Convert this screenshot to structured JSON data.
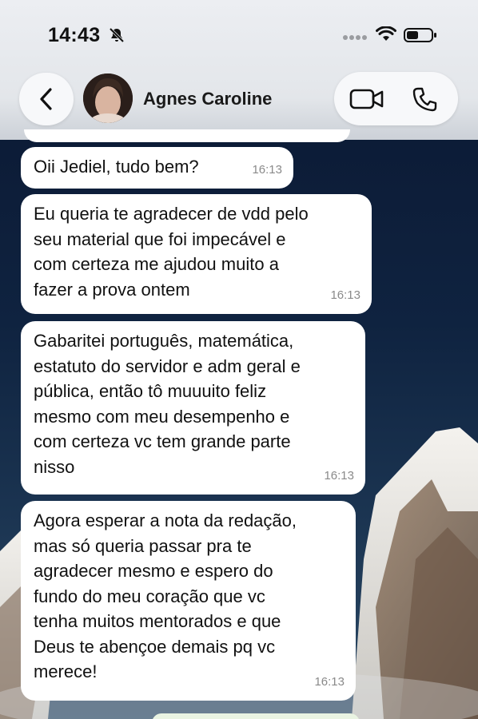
{
  "status_bar": {
    "time": "14:43",
    "icons": [
      "bell-off-icon",
      "signal-icon",
      "wifi-icon",
      "battery-icon"
    ]
  },
  "header": {
    "contact_name": "Agnes Caroline",
    "icons": [
      "chevron-left-icon",
      "video-camera-icon",
      "phone-icon"
    ]
  },
  "messages": [
    {
      "text": "Oii Jediel, tudo bem?",
      "time": "16:13"
    },
    {
      "text": "Eu queria te agradecer de vdd pelo\nseu material que foi impecável e\ncom certeza me ajudou muito a\nfazer a prova ontem",
      "time": "16:13"
    },
    {
      "text": "Gabaritei português, matemática,\nestatuto do servidor e adm geral e\npública, então tô muuuito feliz\nmesmo com meu desempenho e\ncom certeza vc tem grande parte\nnisso",
      "time": "16:13"
    },
    {
      "text": "Agora esperar a nota da redação,\nmas só queria passar pra te\nagradecer mesmo e espero do\nfundo do meu coração que vc\ntenha muitos mentorados e que\nDeus te abençoe demais pq vc\nmerece!",
      "time": "16:13"
    }
  ],
  "colors": {
    "incoming_bubble": "#ffffff",
    "timestamp": "#8a8a8a",
    "header_bg": "#e6e8ec",
    "wallpaper_sky": "#0f2340"
  }
}
